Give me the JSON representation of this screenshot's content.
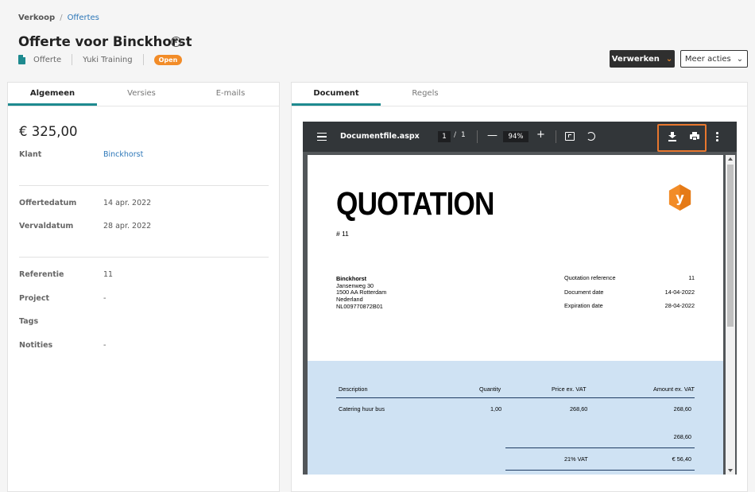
{
  "breadcrumb": {
    "root": "Verkoop",
    "separator": "/",
    "current": "Offertes"
  },
  "header": {
    "title": "Offerte voor Binckhorst",
    "type": "Offerte",
    "administration": "Yuki Training",
    "status": "Open",
    "process_button": "Verwerken",
    "more_button": "Meer acties"
  },
  "left_tabs": [
    "Algemeen",
    "Versies",
    "E-mails"
  ],
  "details": {
    "amount": "€ 325,00",
    "client_label": "Klant",
    "client_value": "Binckhorst",
    "quote_date_label": "Offertedatum",
    "quote_date_value": "14 apr. 2022",
    "due_date_label": "Vervaldatum",
    "due_date_value": "28 apr. 2022",
    "reference_label": "Referentie",
    "reference_value": "11",
    "project_label": "Project",
    "project_value": "-",
    "tags_label": "Tags",
    "notes_label": "Notities",
    "notes_value": "-"
  },
  "right_tabs": [
    "Document",
    "Regels"
  ],
  "viewer": {
    "filename": "Documentfile.aspx",
    "page_current": "1",
    "page_separator": "/",
    "page_total": "1",
    "zoom": "94%",
    "minus": "—",
    "plus": "+"
  },
  "pdf": {
    "title": "QUOTATION",
    "number": "# 11",
    "logo_letter": "y",
    "client_name": "Binckhorst",
    "address1": "Jansenweg 30",
    "address2": "1500 AA Rotterdam",
    "country": "Nederland",
    "vat_number": "NL009770872B01",
    "ref_label": "Quotation reference",
    "ref_value": "11",
    "doc_date_label": "Document date",
    "doc_date_value": "14-04-2022",
    "exp_date_label": "Expiration date",
    "exp_date_value": "28-04-2022",
    "table_headers": [
      "Description",
      "Quantity",
      "Price ex. VAT",
      "Amount ex. VAT"
    ],
    "line_item": {
      "description": "Catering huur bus",
      "quantity": "1,00",
      "price": "268,60",
      "amount": "268,60"
    },
    "subtotal": "268,60",
    "vat_label": "21% VAT",
    "vat_amount": "€ 56,40"
  },
  "colors": {
    "accent": "#1e8a8f",
    "status": "#f28c28",
    "highlight": "#e8772e",
    "link": "#2d77b8",
    "pdf_table_bg": "#cfe2f3"
  }
}
